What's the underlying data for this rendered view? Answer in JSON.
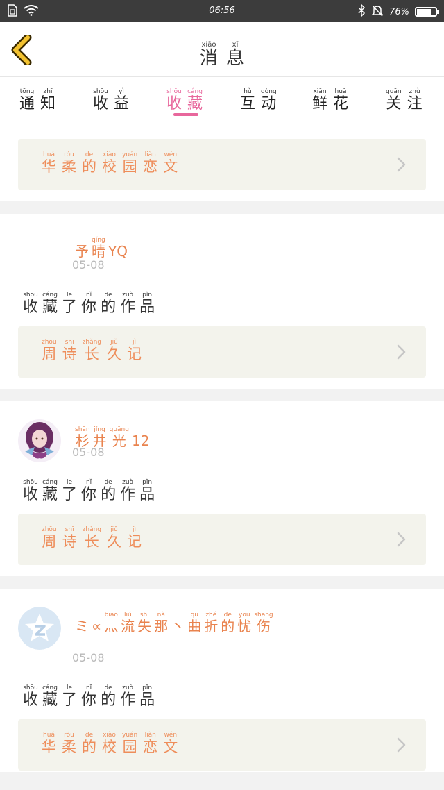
{
  "status_bar": {
    "time": "06:56",
    "battery_text": "76%",
    "battery_level": 0.76
  },
  "header": {
    "title": [
      {
        "py": "xiāo",
        "hz": "消"
      },
      {
        "py": "xī",
        "hz": "息"
      }
    ]
  },
  "tabs": [
    {
      "id": "notice",
      "chars": [
        {
          "py": "tōng",
          "hz": "通"
        },
        {
          "py": "zhī",
          "hz": "知"
        }
      ]
    },
    {
      "id": "income",
      "chars": [
        {
          "py": "shōu",
          "hz": "收"
        },
        {
          "py": "yì",
          "hz": "益"
        }
      ]
    },
    {
      "id": "collect",
      "chars": [
        {
          "py": "shōu",
          "hz": "收"
        },
        {
          "py": "cáng",
          "hz": "藏"
        }
      ],
      "active": true
    },
    {
      "id": "interact",
      "chars": [
        {
          "py": "hù",
          "hz": "互"
        },
        {
          "py": "dòng",
          "hz": "动"
        }
      ]
    },
    {
      "id": "flower",
      "chars": [
        {
          "py": "xiān",
          "hz": "鲜"
        },
        {
          "py": "huā",
          "hz": "花"
        }
      ]
    },
    {
      "id": "follow",
      "chars": [
        {
          "py": "guān",
          "hz": "关"
        },
        {
          "py": "zhù",
          "hz": "注"
        }
      ]
    }
  ],
  "action_text": [
    {
      "py": "shōu",
      "hz": "收"
    },
    {
      "py": "cáng",
      "hz": "藏"
    },
    {
      "py": "le",
      "hz": "了"
    },
    {
      "py": "nǐ",
      "hz": "你"
    },
    {
      "py": "de",
      "hz": "的"
    },
    {
      "py": "zuò",
      "hz": "作"
    },
    {
      "py": "pǐn",
      "hz": "品"
    }
  ],
  "items": [
    {
      "user": null,
      "date": null,
      "show_action": false,
      "work": [
        {
          "py": "huá",
          "hz": "华"
        },
        {
          "py": "róu",
          "hz": "柔"
        },
        {
          "py": "de",
          "hz": "的"
        },
        {
          "py": "xiào",
          "hz": "校"
        },
        {
          "py": "yuán",
          "hz": "园"
        },
        {
          "py": "liàn",
          "hz": "恋"
        },
        {
          "py": "wén",
          "hz": "文"
        }
      ]
    },
    {
      "user": [
        {
          "py": "",
          "hz": "予"
        },
        {
          "py": "qíng",
          "hz": "晴"
        },
        {
          "py": "",
          "hz": "YQ"
        }
      ],
      "date": "05-08",
      "show_action": true,
      "avatar": "none",
      "work": [
        {
          "py": "zhōu",
          "hz": "周"
        },
        {
          "py": "shī",
          "hz": "诗"
        },
        {
          "py": "zhǎng",
          "hz": "长"
        },
        {
          "py": "jiǔ",
          "hz": "久"
        },
        {
          "py": "jì",
          "hz": "记"
        }
      ]
    },
    {
      "user": [
        {
          "py": "shān",
          "hz": "杉"
        },
        {
          "py": "jǐng",
          "hz": "井"
        },
        {
          "py": "guāng",
          "hz": "光"
        },
        {
          "py": "",
          "hz": "12"
        }
      ],
      "date": "05-08",
      "show_action": true,
      "avatar": "anime-girl",
      "work": [
        {
          "py": "zhōu",
          "hz": "周"
        },
        {
          "py": "shī",
          "hz": "诗"
        },
        {
          "py": "zhǎng",
          "hz": "长"
        },
        {
          "py": "jiǔ",
          "hz": "久"
        },
        {
          "py": "jì",
          "hz": "记"
        }
      ]
    },
    {
      "user": [
        {
          "py": "",
          "hz": "ミ"
        },
        {
          "py": "",
          "hz": "∝"
        },
        {
          "py": "biāo",
          "hz": "灬"
        },
        {
          "py": "liú",
          "hz": "流"
        },
        {
          "py": "shī",
          "hz": "失"
        },
        {
          "py": "nà",
          "hz": "那"
        },
        {
          "py": "",
          "hz": "丶"
        },
        {
          "py": "qū",
          "hz": "曲"
        },
        {
          "py": "zhé",
          "hz": "折"
        },
        {
          "py": "de",
          "hz": "的"
        },
        {
          "py": "yōu",
          "hz": "忧"
        },
        {
          "py": "shāng",
          "hz": "伤"
        }
      ],
      "date": "05-08",
      "show_action": true,
      "avatar": "qzone",
      "work": [
        {
          "py": "huá",
          "hz": "华"
        },
        {
          "py": "róu",
          "hz": "柔"
        },
        {
          "py": "de",
          "hz": "的"
        },
        {
          "py": "xiào",
          "hz": "校"
        },
        {
          "py": "yuán",
          "hz": "园"
        },
        {
          "py": "liàn",
          "hz": "恋"
        },
        {
          "py": "wén",
          "hz": "文"
        }
      ]
    }
  ],
  "colors": {
    "accent_pink": "#e8679c",
    "work_orange": "#ee8d5a",
    "user_orange": "#e9834e",
    "back_yellow": "#f2c230"
  }
}
